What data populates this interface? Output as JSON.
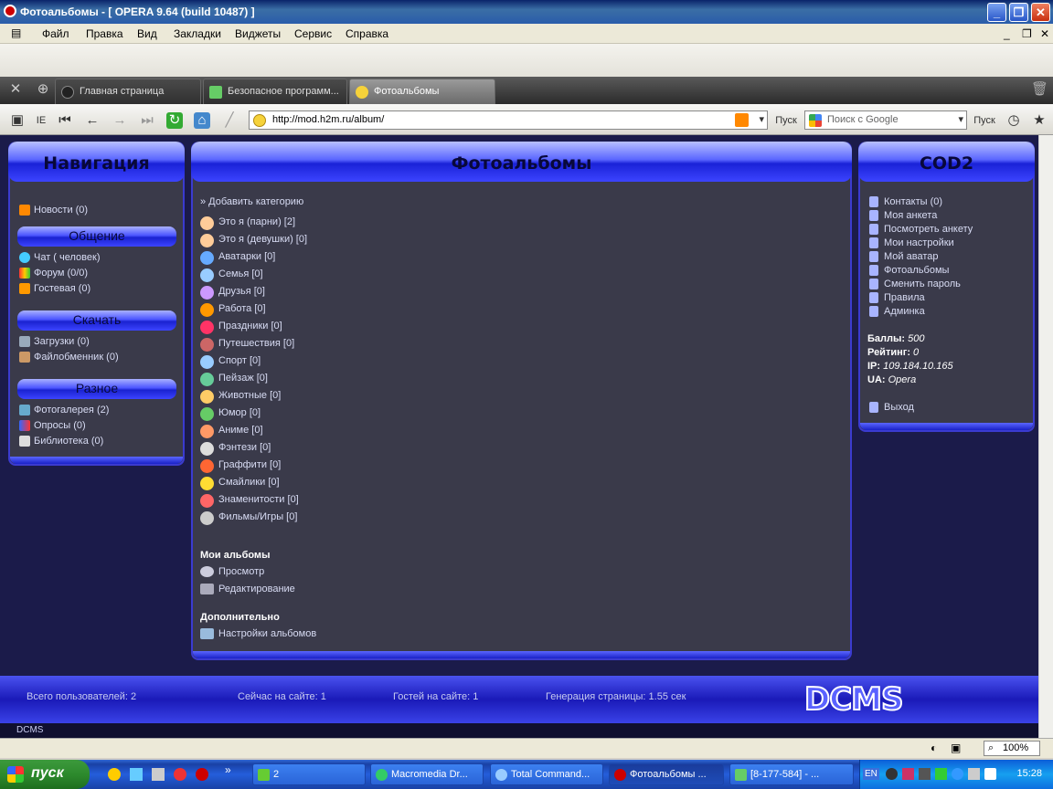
{
  "window": {
    "title": "Фотоальбомы - [ OPERA 9.64 (build 10487) ]"
  },
  "menu": [
    "Файл",
    "Правка",
    "Вид",
    "Закладки",
    "Виджеты",
    "Сервис",
    "Справка"
  ],
  "tabs": [
    {
      "label": "Главная страница"
    },
    {
      "label": "Безопасное программ..."
    },
    {
      "label": "Фотоальбомы"
    }
  ],
  "toolbar": {
    "ie_label": "IE",
    "go_label": "Пуск",
    "search_go_label": "Пуск"
  },
  "address": {
    "url": "http://mod.h2m.ru/album/"
  },
  "search": {
    "placeholder": "Поиск с Google"
  },
  "nav": {
    "title": "Навигация",
    "news": "Новости (0)",
    "sections": [
      {
        "title": "Общение",
        "items": [
          "Чат ( человек)",
          "Форум (0/0)",
          "Гостевая (0)"
        ]
      },
      {
        "title": "Скачать",
        "items": [
          "Загрузки (0)",
          "Файлобменник (0)"
        ]
      },
      {
        "title": "Разное",
        "items": [
          "Фотогалерея (2)",
          "Опросы (0)",
          "Библиотека (0)"
        ]
      }
    ]
  },
  "main": {
    "title": "Фотоальбомы",
    "add_category": "» Добавить категорию",
    "categories": [
      "Это я (парни) [2]",
      "Это я (девушки) [0]",
      "Аватарки [0]",
      "Семья [0]",
      "Друзья [0]",
      "Работа [0]",
      "Праздники [0]",
      "Путешествия [0]",
      "Спорт [0]",
      "Пейзаж [0]",
      "Животные [0]",
      "Юмор [0]",
      "Аниме [0]",
      "Фэнтези [0]",
      "Граффити [0]",
      "Смайлики [0]",
      "Знаменитости [0]",
      "Фильмы/Игры [0]"
    ],
    "my_albums_heading": "Мои альбомы",
    "my_albums": [
      "Просмотр",
      "Редактирование"
    ],
    "extra_heading": "Дополнительно",
    "extra": [
      "Настройки альбомов"
    ]
  },
  "user": {
    "title": "COD2",
    "links": [
      "Контакты (0)",
      "Моя анкета",
      "Посмотреть анкету",
      "Мои настройки",
      "Мой аватар",
      "Фотоальбомы",
      "Сменить пароль",
      "Правила",
      "Админка"
    ],
    "stats": [
      {
        "label": "Баллы:",
        "value": "500"
      },
      {
        "label": "Рейтинг:",
        "value": "0"
      },
      {
        "label": "IP:",
        "value": "109.184.10.165"
      },
      {
        "label": "UA:",
        "value": "Opera"
      }
    ],
    "logout": "Выход"
  },
  "footer": {
    "users_total": "Всего пользователей: 2",
    "online": "Сейчас на сайте: 1",
    "guests": "Гостей на сайте: 1",
    "generation": "Генерация страницы: 1.55 сек",
    "logo": "DCMS",
    "bar_label": "DCMS"
  },
  "status": {
    "zoom": "100%"
  },
  "taskbar": {
    "start": "пуск",
    "items": [
      "2",
      "Macromedia Dr...",
      "Total Command...",
      "Фотоальбомы ...",
      "[8-177-584] - ..."
    ],
    "lang": "EN",
    "clock": "15:28"
  }
}
